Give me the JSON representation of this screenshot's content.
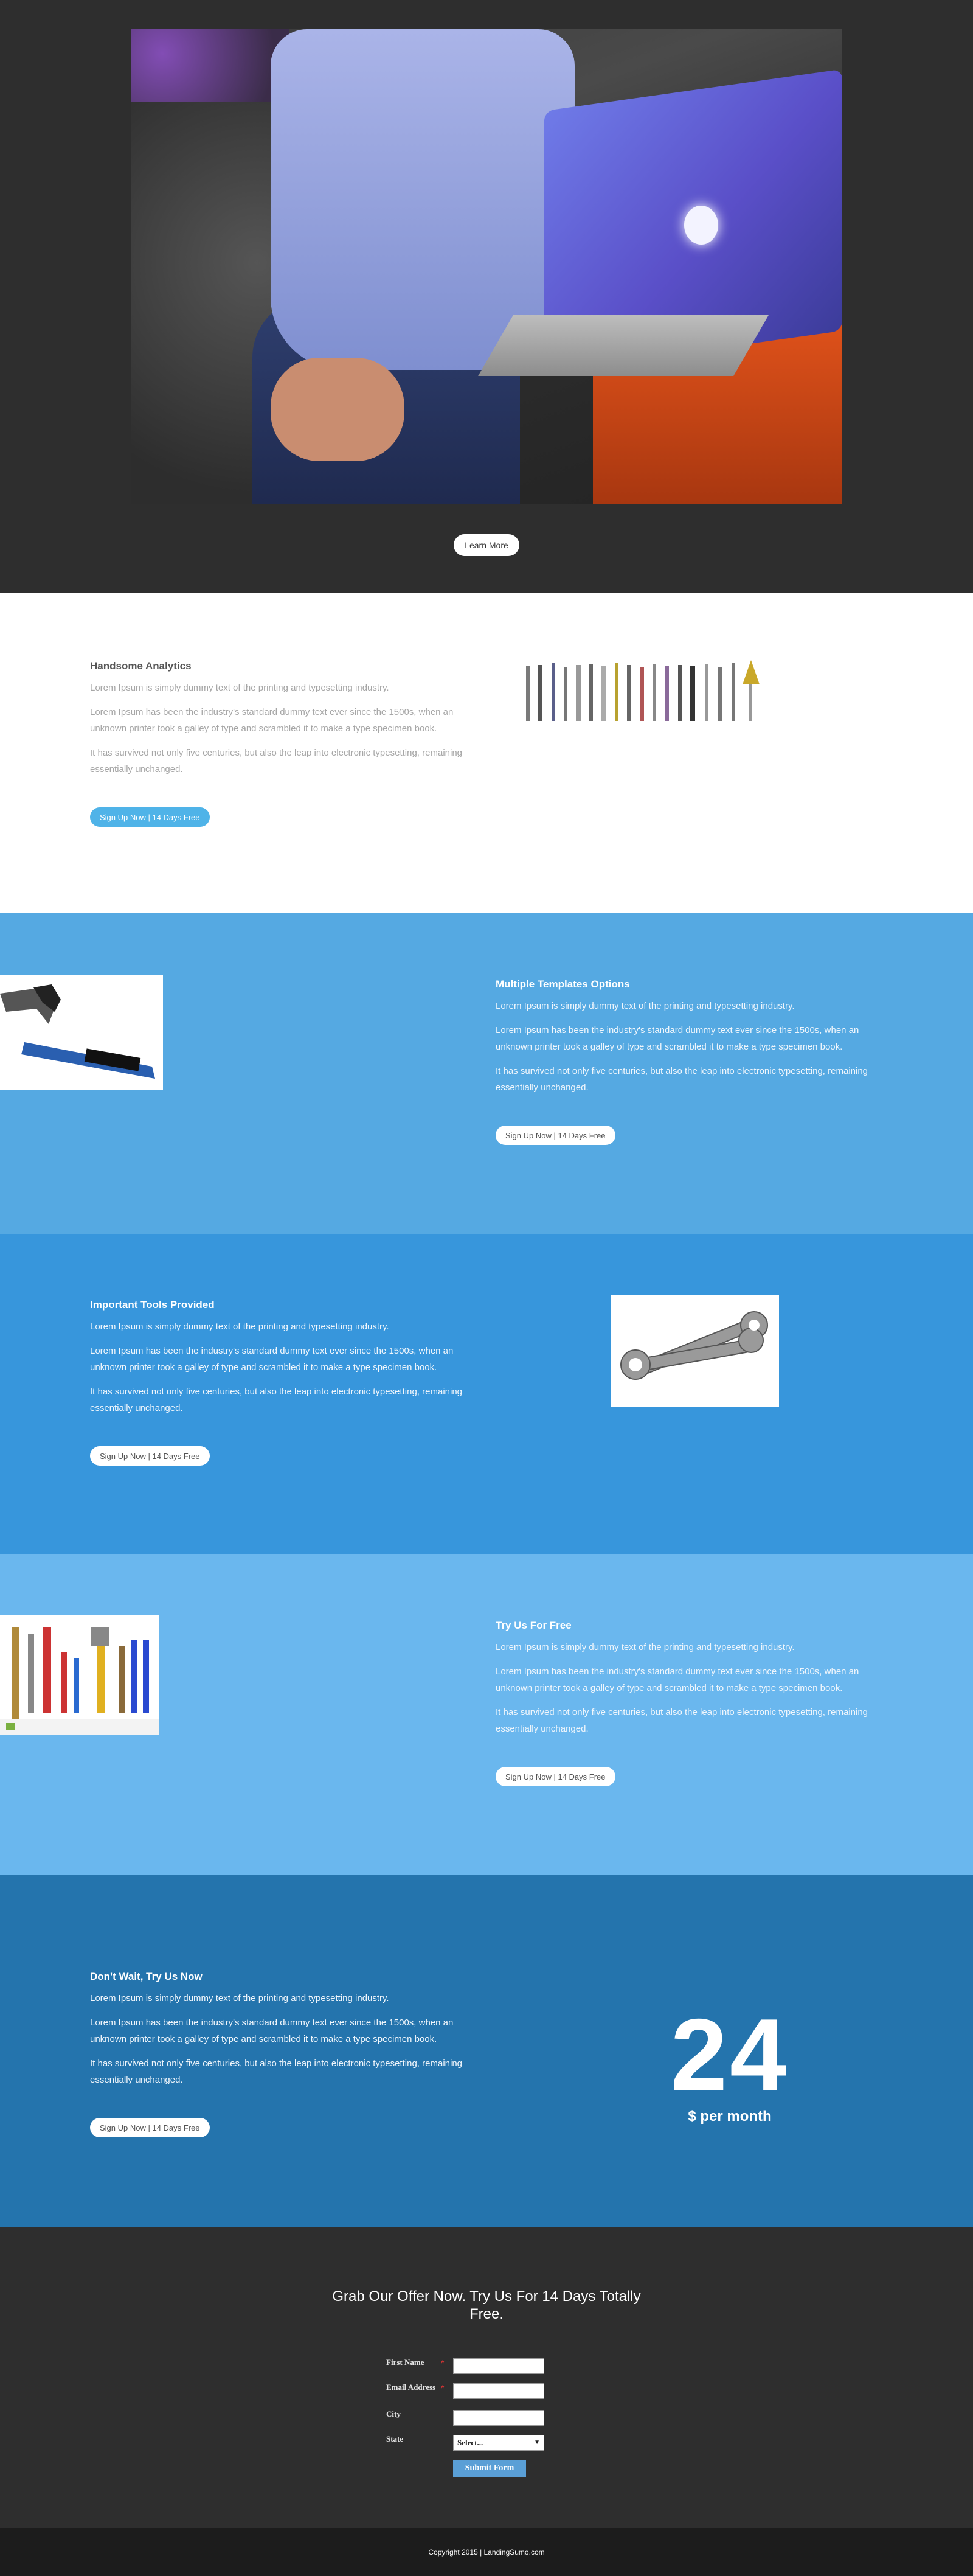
{
  "hero": {
    "learn_more_label": "Learn More"
  },
  "features": [
    {
      "title": "Handsome Analytics",
      "paragraphs": [
        "Lorem Ipsum is simply dummy text of the printing and typesetting industry.",
        "Lorem Ipsum has been the industry's standard dummy text ever since the 1500s, when an unknown printer took a galley of type and scrambled it to make a type specimen book.",
        "It has survived not only five centuries, but also the leap into electronic typesetting, remaining essentially unchanged."
      ],
      "button_label": "Sign Up Now | 14 Days Free",
      "image_icon": "drill-bits-image"
    },
    {
      "title": "Multiple Templates Options",
      "paragraphs": [
        "Lorem Ipsum is simply dummy text of the printing and typesetting industry.",
        "Lorem Ipsum has been the industry's standard dummy text ever since the 1500s, when an unknown printer took a galley of type and scrambled it to make a type specimen book.",
        "It has survived not only five centuries, but also the leap into electronic typesetting, remaining essentially unchanged."
      ],
      "button_label": "Sign Up Now | 14 Days Free",
      "image_icon": "hammer-image"
    },
    {
      "title": "Important Tools Provided",
      "paragraphs": [
        "Lorem Ipsum is simply dummy text of the printing and typesetting industry.",
        "Lorem Ipsum has been the industry's standard dummy text ever since the 1500s, when an unknown printer took a galley of type and scrambled it to make a type specimen book.",
        "It has survived not only five centuries, but also the leap into electronic typesetting, remaining essentially unchanged."
      ],
      "button_label": "Sign Up Now | 14 Days Free",
      "image_icon": "wrenches-image"
    },
    {
      "title": "Try Us For Free",
      "paragraphs": [
        "Lorem Ipsum is simply dummy text of the printing and typesetting industry.",
        "Lorem Ipsum has been the industry's standard dummy text ever since the 1500s, when an unknown printer took a galley of type and scrambled it to make a type specimen book.",
        "It has survived not only five centuries, but also the leap into electronic typesetting, remaining essentially unchanged."
      ],
      "button_label": "Sign Up Now | 14 Days Free",
      "image_icon": "toolset-image"
    },
    {
      "title": "Don't Wait, Try Us Now",
      "paragraphs": [
        "Lorem Ipsum is simply dummy text of the printing and typesetting industry.",
        "Lorem Ipsum has been the industry's standard dummy text ever since the 1500s, when an unknown printer took a galley of type and scrambled it to make a type specimen book.",
        "It has survived not only five centuries, but also the leap into electronic typesetting, remaining essentially unchanged."
      ],
      "button_label": "Sign Up Now | 14 Days Free"
    }
  ],
  "price": {
    "amount": "24",
    "label": "$ per month"
  },
  "form": {
    "title": "Grab Our Offer Now. Try Us For 14 Days Totally Free.",
    "fields": [
      {
        "label": "First Name",
        "required_mark": "*",
        "value": ""
      },
      {
        "label": "Email Address",
        "required_mark": "*",
        "value": ""
      },
      {
        "label": "City",
        "required_mark": "",
        "value": ""
      }
    ],
    "state_label": "State",
    "state_selected": "Select...",
    "submit_label": "Submit Form"
  },
  "footer": {
    "copyright": "Copyright 2015 | LandingSumo.com"
  },
  "colors": {
    "dark_bg": "#2e2e2e",
    "blue_1": "#55a9e2",
    "blue_2": "#3796dc",
    "blue_3": "#6ab7ee",
    "blue_4": "#2474ad",
    "footer_bg": "#1c1c1c"
  }
}
